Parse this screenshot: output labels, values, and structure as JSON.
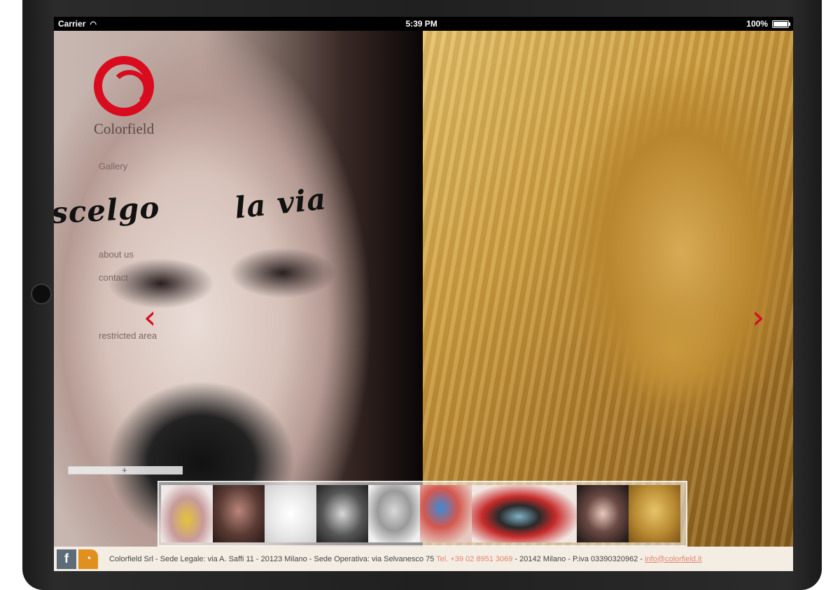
{
  "statusbar": {
    "carrier": "Carrier",
    "time": "5:39 PM",
    "battery": "100%"
  },
  "logo": {
    "name": "Colorfield"
  },
  "hero": {
    "left_eye_text": "scelgo",
    "right_eye_text": "la via"
  },
  "nav": {
    "items": [
      "Gallery",
      "about us",
      "contact",
      "restricted area"
    ]
  },
  "arrows": {
    "prev": "‹",
    "next": "›"
  },
  "slider": {
    "knob": "+"
  },
  "thumbnails": {
    "count": 11
  },
  "footer": {
    "facebook": "f",
    "company": "Colorfield Srl - Sede Legale: via A. Saffi 11 - 20123 Milano - Sede Operativa: via Selvanesco 75 ",
    "phone": "Tel. +39 02 8951 3069",
    "address_tail": " - 20142 Milano - P.iva 03390320962 - ",
    "email": "info@colorfield.it"
  },
  "colors": {
    "accent_red": "#d90b1f",
    "footer_link": "#e0866d",
    "nav_text": "#7b6762"
  }
}
